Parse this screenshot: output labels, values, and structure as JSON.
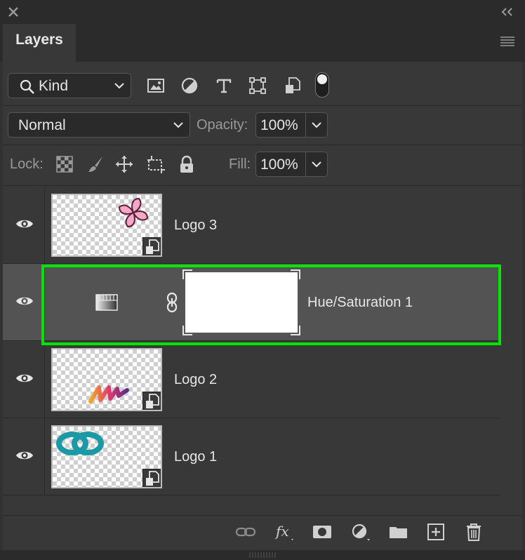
{
  "panel": {
    "tab_title": "Layers",
    "filter_kind_label": "Kind",
    "blend_mode": "Normal",
    "opacity_label": "Opacity:",
    "opacity_value": "100%",
    "lock_label": "Lock:",
    "fill_label": "Fill:",
    "fill_value": "100%"
  },
  "layers": [
    {
      "name": "Logo 3",
      "type": "smart-object",
      "visible": true,
      "selected": false
    },
    {
      "name": "Hue/Saturation 1",
      "type": "adjustment",
      "visible": true,
      "selected": true
    },
    {
      "name": "Logo 2",
      "type": "smart-object",
      "visible": true,
      "selected": false
    },
    {
      "name": "Logo 1",
      "type": "smart-object",
      "visible": true,
      "selected": false
    }
  ],
  "colors": {
    "highlight": "#00e600",
    "selected_row": "#535353",
    "panel_bg": "#383838"
  },
  "icons": {
    "filter": [
      "image-icon",
      "adjustment-circle-icon",
      "type-icon",
      "shape-icon",
      "smart-object-icon"
    ],
    "lock": [
      "lock-transparent-icon",
      "lock-paint-icon",
      "lock-move-icon",
      "lock-artboard-icon",
      "lock-all-icon"
    ],
    "bottom": [
      "link-layers-icon",
      "fx-icon",
      "add-mask-icon",
      "new-adjustment-icon",
      "new-group-icon",
      "new-layer-icon",
      "delete-icon"
    ]
  }
}
